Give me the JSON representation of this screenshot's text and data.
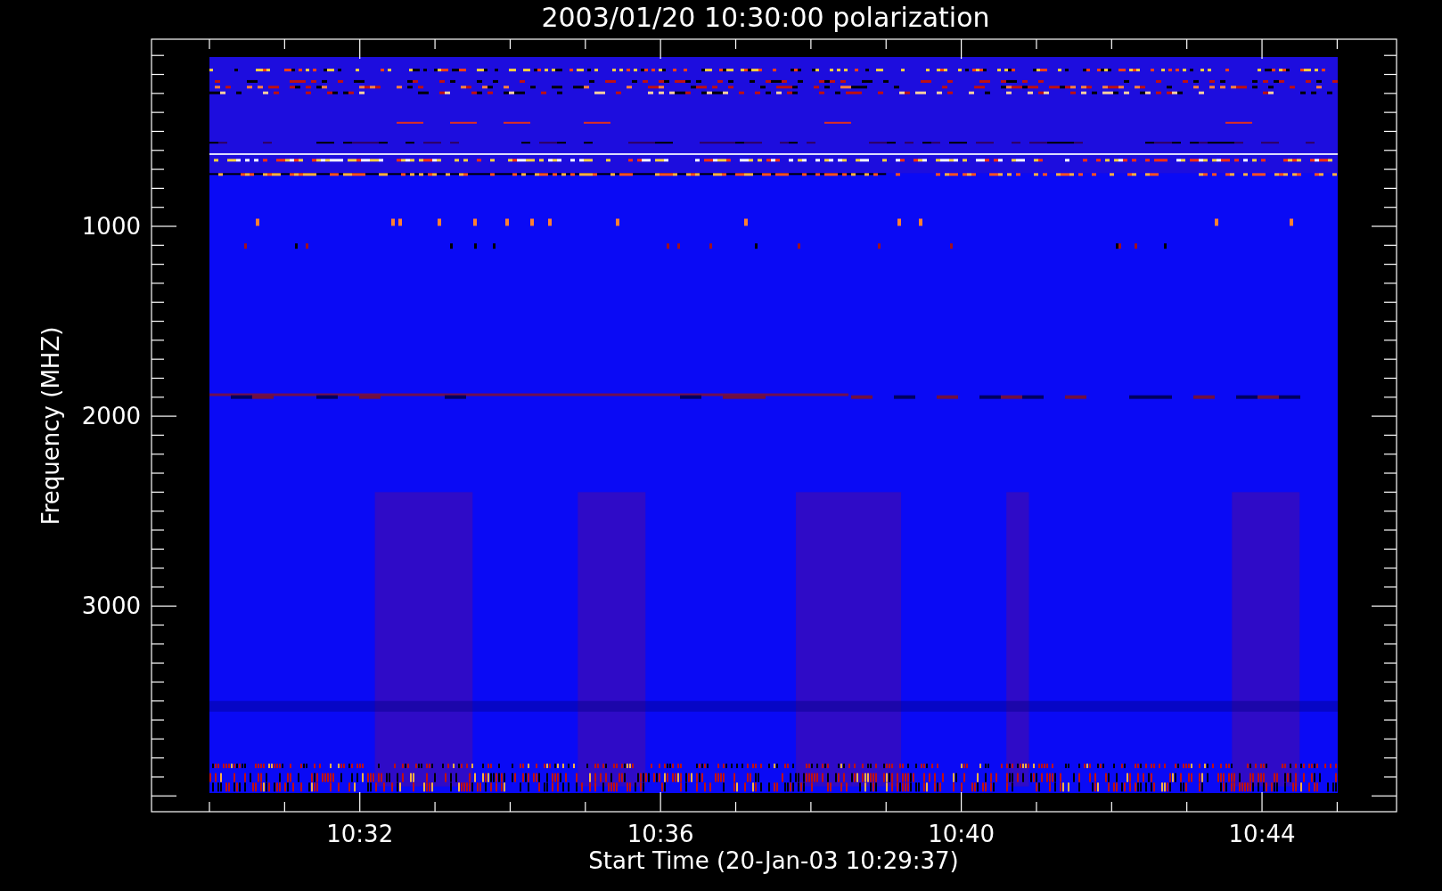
{
  "title": "2003/01/20 10:30:00 polarization",
  "plot": {
    "ylabel": "Frequency (MHZ)",
    "yticks": [
      "1000",
      "2000",
      "3000"
    ],
    "xlabel": "Start Time (20-Jan-03 10:29:37)",
    "xticks": [
      "10:32",
      "10:36",
      "10:40",
      "10:44"
    ]
  }
}
